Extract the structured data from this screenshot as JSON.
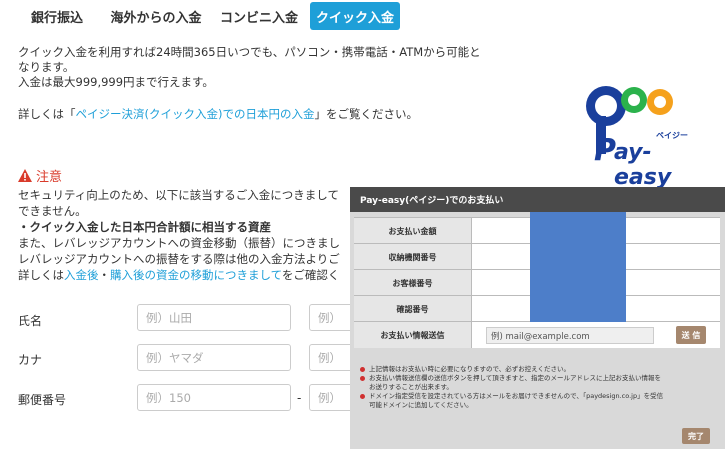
{
  "tabs": [
    {
      "label": "銀行振込"
    },
    {
      "label": "海外からの入金"
    },
    {
      "label": "コンビニ入金"
    },
    {
      "label": "クイック入金"
    }
  ],
  "intro": {
    "line1": "クイック入金を利用すれば24時間365日いつでも、パソコン・携帯電話・ATMから可能と",
    "line2": "なります。",
    "line3": "入金は最大999,999円まで行えます。"
  },
  "details": {
    "prefix": "詳しくは「",
    "link": "ペイジー決済(クイック入金)での日本円の入金",
    "suffix": "」をご覧ください。"
  },
  "caution": {
    "title": "注意",
    "line1": "セキュリティ向上のため、以下に該当するご入金につきまして",
    "line2": "できません。",
    "line3": "・クイック入金した日本円合計額に相当する資産",
    "line4": "また、レバレッジアカウントへの資金移動（振替）につきまし",
    "line5": "レバレッジアカウントへの振替をする際は他の入金方法よりご",
    "line6_prefix": "詳しくは",
    "line6_link1": "入金後",
    "line6_sep": "・",
    "line6_link2": "購入後の資金の移動につきまして",
    "line6_suffix": "をご確認く"
  },
  "form": {
    "name_label": "氏名",
    "name_placeholder": "例）山田",
    "name2_placeholder": "例）",
    "kana_label": "カナ",
    "kana_placeholder": "例）ヤマダ",
    "kana2_placeholder": "例）",
    "zip_label": "郵便番号",
    "zip_placeholder": "例）150",
    "zip_dash": "-",
    "zip2_placeholder": "例）"
  },
  "logo": {
    "text": "ay-easy",
    "kana": "ペイジー",
    "letter": "P"
  },
  "overlay": {
    "header": "Pay-easy(ペイジー)でのお支払い",
    "rows": [
      {
        "label": "お支払い金額"
      },
      {
        "label": "収納機関番号"
      },
      {
        "label": "お客様番号"
      },
      {
        "label": "確認番号"
      },
      {
        "label": "お支払い情報送信"
      }
    ],
    "email_placeholder": "例) mail@example.com",
    "send_label": "送 信",
    "notes": [
      "上記情報はお支払い時に必要になりますので、必ずお控えください。",
      "お支払い情報送信欄の送信ボタンを押して頂きますと、指定のメールアドレスに上記お支払い情報を",
      "お送りすることが出来ます。",
      "ドメイン指定受信を設定されている方はメールをお届けできませんので、「paydesign.co.jp」を受信",
      "可能ドメインに追加してください。"
    ],
    "done_label": "完了"
  },
  "colors": {
    "accent": "#1e9fd8",
    "warning": "#d93b2b",
    "overlay_button": "#a5876e",
    "redacted": "#4d7ec9"
  }
}
